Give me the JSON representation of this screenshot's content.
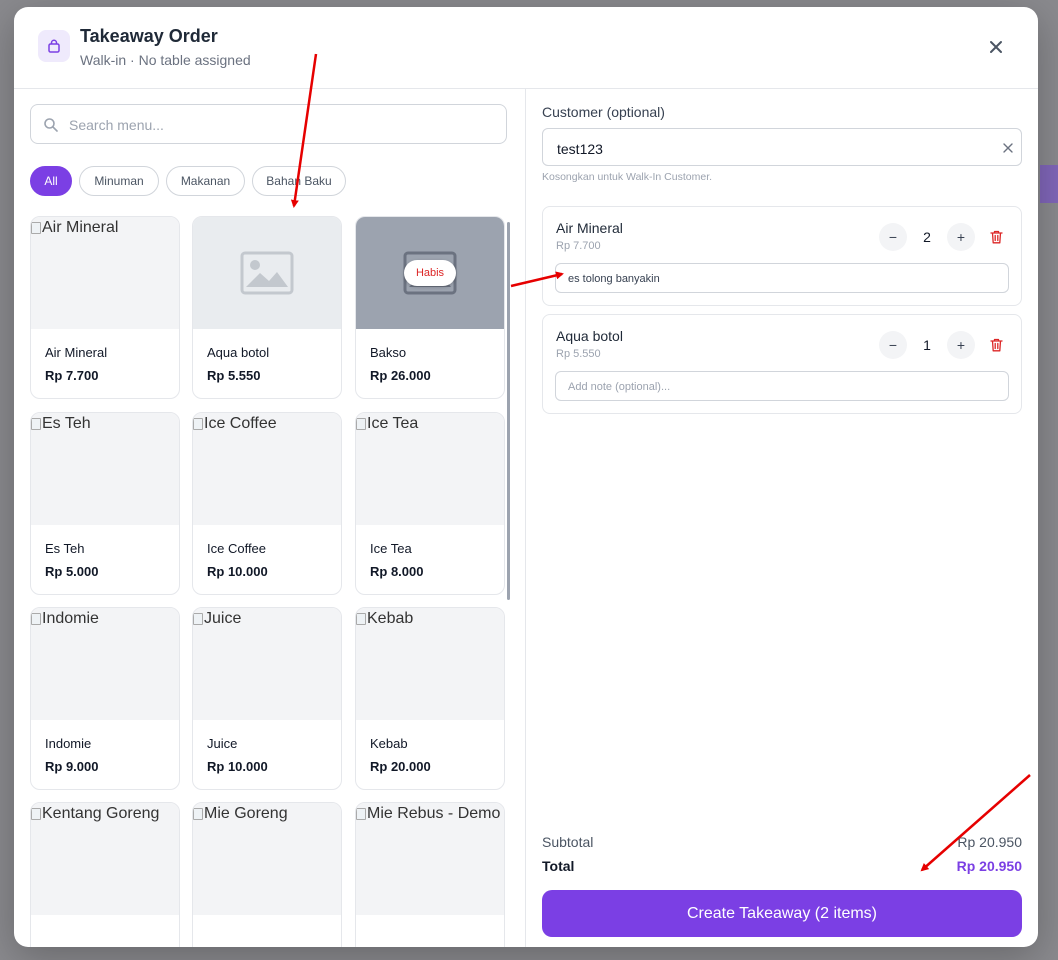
{
  "header": {
    "title": "Takeaway Order",
    "subtitle": "Walk-in · No table assigned",
    "icon": "shopping-bag-icon"
  },
  "search": {
    "placeholder": "Search menu...",
    "value": ""
  },
  "categories": [
    {
      "label": "All",
      "active": true
    },
    {
      "label": "Minuman",
      "active": false
    },
    {
      "label": "Makanan",
      "active": false
    },
    {
      "label": "Bahan Baku",
      "active": false
    }
  ],
  "menu": [
    {
      "name": "Air Mineral",
      "price": "Rp 7.700",
      "image": "broken",
      "alt": "Air Mineral"
    },
    {
      "name": "Aqua botol",
      "price": "Rp 5.550",
      "image": "placeholder",
      "alt": ""
    },
    {
      "name": "Bakso",
      "price": "Rp 26.000",
      "image": "soldout",
      "alt": "",
      "badge": "Habis"
    },
    {
      "name": "Es Teh",
      "price": "Rp 5.000",
      "image": "broken",
      "alt": "Es Teh"
    },
    {
      "name": "Ice Coffee",
      "price": "Rp 10.000",
      "image": "broken",
      "alt": "Ice Coffee"
    },
    {
      "name": "Ice Tea",
      "price": "Rp 8.000",
      "image": "broken",
      "alt": "Ice Tea"
    },
    {
      "name": "Indomie",
      "price": "Rp 9.000",
      "image": "broken",
      "alt": "Indomie"
    },
    {
      "name": "Juice",
      "price": "Rp 10.000",
      "image": "broken",
      "alt": "Juice"
    },
    {
      "name": "Kebab",
      "price": "Rp 20.000",
      "image": "broken",
      "alt": "Kebab"
    },
    {
      "name": "",
      "price": "",
      "image": "broken",
      "alt": "Kentang Goreng"
    },
    {
      "name": "",
      "price": "",
      "image": "broken",
      "alt": "Mie Goreng"
    },
    {
      "name": "",
      "price": "",
      "image": "broken",
      "alt": "Mie Rebus - Demo"
    }
  ],
  "customer": {
    "label": "Customer (optional)",
    "value": "test123",
    "help": "Kosongkan untuk Walk-In Customer."
  },
  "cart": [
    {
      "name": "Air Mineral",
      "price": "Rp 7.700",
      "qty": "2",
      "note": "es tolong banyakin",
      "note_placeholder": "Add note (optional)..."
    },
    {
      "name": "Aqua botol",
      "price": "Rp 5.550",
      "qty": "1",
      "note": "",
      "note_placeholder": "Add note (optional)..."
    }
  ],
  "summary": {
    "subtotal_label": "Subtotal",
    "subtotal": "Rp 20.950",
    "total_label": "Total",
    "total": "Rp 20.950"
  },
  "create_button": "Create Takeaway (2 items)",
  "colors": {
    "accent": "#7b3fe4",
    "danger": "#dc2626",
    "annotation": "#e60000"
  }
}
